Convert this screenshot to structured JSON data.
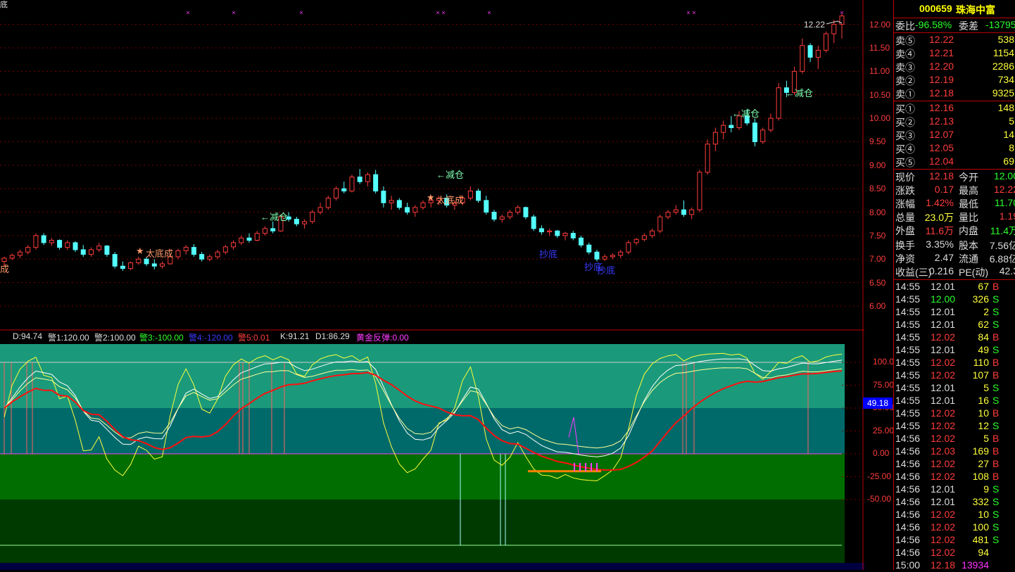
{
  "stock": {
    "code": "000659",
    "name": "珠海中富"
  },
  "order_book": {
    "wei_bi_label": "委比",
    "wei_bi": "-96.58%",
    "wei_cha_label": "委差",
    "wei_cha": "-13795",
    "sell": [
      {
        "label": "卖⑤",
        "price": "12.22",
        "vol": "538"
      },
      {
        "label": "卖④",
        "price": "12.21",
        "vol": "1154"
      },
      {
        "label": "卖③",
        "price": "12.20",
        "vol": "2286"
      },
      {
        "label": "卖②",
        "price": "12.19",
        "vol": "734"
      },
      {
        "label": "卖①",
        "price": "12.18",
        "vol": "9325"
      }
    ],
    "buy": [
      {
        "label": "买①",
        "price": "12.16",
        "vol": "148"
      },
      {
        "label": "买②",
        "price": "12.13",
        "vol": "5"
      },
      {
        "label": "买③",
        "price": "12.07",
        "vol": "14"
      },
      {
        "label": "买④",
        "price": "12.05",
        "vol": "8"
      },
      {
        "label": "买⑤",
        "price": "12.04",
        "vol": "69"
      }
    ]
  },
  "quote": [
    {
      "l1": "现价",
      "v1": "12.18",
      "c1": "r",
      "l2": "今开",
      "v2": "12.00",
      "c2": "g"
    },
    {
      "l1": "涨跌",
      "v1": "0.17",
      "c1": "r",
      "l2": "最高",
      "v2": "12.22",
      "c2": "r"
    },
    {
      "l1": "涨幅",
      "v1": "1.42%",
      "c1": "r",
      "l2": "最低",
      "v2": "11.70",
      "c2": "g"
    },
    {
      "l1": "总量",
      "v1": "23.0万",
      "c1": "y",
      "l2": "量比",
      "v2": "1.19",
      "c2": "r"
    },
    {
      "l1": "外盘",
      "v1": "11.6万",
      "c1": "r",
      "l2": "内盘",
      "v2": "11.4万",
      "c2": "g"
    },
    {
      "l1": "换手",
      "v1": "3.35%",
      "c1": "w",
      "l2": "股本",
      "v2": "7.56亿",
      "c2": "w"
    },
    {
      "l1": "净资",
      "v1": "2.47",
      "c1": "w",
      "l2": "流通",
      "v2": "6.88亿",
      "c2": "w"
    },
    {
      "l1": "收益(三)",
      "v1": "0.216",
      "c1": "w",
      "l2": "PE(动)",
      "v2": "42.3",
      "c2": "w"
    }
  ],
  "ticks": [
    {
      "t": "14:55",
      "p": "12.01",
      "pc": "w",
      "v": "67",
      "s": "B"
    },
    {
      "t": "14:55",
      "p": "12.00",
      "pc": "g",
      "v": "326",
      "s": "S"
    },
    {
      "t": "14:55",
      "p": "12.01",
      "pc": "w",
      "v": "2",
      "s": "S"
    },
    {
      "t": "14:55",
      "p": "12.01",
      "pc": "w",
      "v": "62",
      "s": "S"
    },
    {
      "t": "14:55",
      "p": "12.02",
      "pc": "r",
      "v": "84",
      "s": "B"
    },
    {
      "t": "14:55",
      "p": "12.01",
      "pc": "w",
      "v": "49",
      "s": "S"
    },
    {
      "t": "14:55",
      "p": "12.02",
      "pc": "r",
      "v": "110",
      "s": "B"
    },
    {
      "t": "14:55",
      "p": "12.02",
      "pc": "r",
      "v": "107",
      "s": "B"
    },
    {
      "t": "14:55",
      "p": "12.01",
      "pc": "w",
      "v": "5",
      "s": "S"
    },
    {
      "t": "14:55",
      "p": "12.01",
      "pc": "w",
      "v": "16",
      "s": "S"
    },
    {
      "t": "14:55",
      "p": "12.02",
      "pc": "r",
      "v": "10",
      "s": "B"
    },
    {
      "t": "14:55",
      "p": "12.02",
      "pc": "r",
      "v": "12",
      "s": "S"
    },
    {
      "t": "14:56",
      "p": "12.02",
      "pc": "r",
      "v": "5",
      "s": "B"
    },
    {
      "t": "14:56",
      "p": "12.03",
      "pc": "r",
      "v": "169",
      "s": "B"
    },
    {
      "t": "14:56",
      "p": "12.02",
      "pc": "r",
      "v": "27",
      "s": "B"
    },
    {
      "t": "14:56",
      "p": "12.02",
      "pc": "r",
      "v": "108",
      "s": "B"
    },
    {
      "t": "14:56",
      "p": "12.01",
      "pc": "w",
      "v": "9",
      "s": "S"
    },
    {
      "t": "14:56",
      "p": "12.01",
      "pc": "w",
      "v": "332",
      "s": "S"
    },
    {
      "t": "14:56",
      "p": "12.02",
      "pc": "r",
      "v": "10",
      "s": "S"
    },
    {
      "t": "14:56",
      "p": "12.02",
      "pc": "r",
      "v": "100",
      "s": "S"
    },
    {
      "t": "14:56",
      "p": "12.02",
      "pc": "r",
      "v": "481",
      "s": "S"
    },
    {
      "t": "14:56",
      "p": "12.02",
      "pc": "r",
      "v": "94",
      "s": ""
    },
    {
      "t": "15:00",
      "p": "12.18",
      "pc": "r",
      "v": "13934",
      "s": ""
    }
  ],
  "indicator_legend": [
    {
      "text": "D:94.74",
      "color": "#dddddd"
    },
    {
      "text": "警1:120.00",
      "color": "#dddddd"
    },
    {
      "text": "警2:100.00",
      "color": "#dddddd"
    },
    {
      "text": "警3:-100.00",
      "color": "#2cff2c"
    },
    {
      "text": "警4:-120.00",
      "color": "#3a3aff"
    },
    {
      "text": "警5:0.01",
      "color": "#ff3c3c"
    },
    {
      "text": "K:91.21",
      "color": "#dddddd"
    },
    {
      "text": "D1:86.29",
      "color": "#dddddd"
    },
    {
      "text": "黄金反弹:0.00",
      "color": "#ff3cff"
    }
  ],
  "main_axis": [
    "12.00",
    "11.50",
    "11.00",
    "10.50",
    "10.00",
    "9.50",
    "9.00",
    "8.50",
    "8.00",
    "7.50",
    "7.00",
    "6.50",
    "6.00"
  ],
  "ind_axis": [
    "100.0",
    "75.00",
    "50.00",
    "25.00",
    "0.00",
    "-25.00",
    "-50.00"
  ],
  "ind_current": "49.18",
  "annotations": {
    "high_label": "12.22",
    "jiancang": "←减仓",
    "taichengcheng": "太底成",
    "chaodi": "抄底",
    "left_edge": "成",
    "top_left": "底"
  },
  "chart_data": {
    "type": "candlestick",
    "ylim": [
      5.7,
      12.4
    ],
    "ohlc": [
      [
        6.95,
        7.05,
        6.85,
        7.02
      ],
      [
        7.02,
        7.12,
        6.98,
        7.08
      ],
      [
        7.08,
        7.2,
        7.02,
        7.15
      ],
      [
        7.15,
        7.3,
        7.1,
        7.25
      ],
      [
        7.25,
        7.55,
        7.2,
        7.5
      ],
      [
        7.5,
        7.55,
        7.3,
        7.35
      ],
      [
        7.35,
        7.45,
        7.28,
        7.4
      ],
      [
        7.4,
        7.42,
        7.2,
        7.25
      ],
      [
        7.25,
        7.4,
        7.2,
        7.35
      ],
      [
        7.35,
        7.38,
        7.15,
        7.2
      ],
      [
        7.2,
        7.3,
        7.05,
        7.1
      ],
      [
        7.1,
        7.25,
        7.05,
        7.2
      ],
      [
        7.2,
        7.35,
        7.15,
        7.28
      ],
      [
        7.28,
        7.3,
        7.05,
        7.1
      ],
      [
        7.1,
        7.15,
        6.8,
        6.85
      ],
      [
        6.85,
        6.95,
        6.75,
        6.8
      ],
      [
        6.8,
        6.95,
        6.76,
        6.92
      ],
      [
        6.92,
        7.05,
        6.88,
        7.0
      ],
      [
        7.0,
        7.05,
        6.85,
        6.9
      ],
      [
        6.9,
        7.0,
        6.78,
        6.85
      ],
      [
        6.85,
        6.95,
        6.8,
        6.9
      ],
      [
        6.9,
        7.1,
        6.88,
        7.05
      ],
      [
        7.05,
        7.22,
        7.0,
        7.18
      ],
      [
        7.18,
        7.3,
        7.1,
        7.25
      ],
      [
        7.25,
        7.32,
        7.05,
        7.1
      ],
      [
        7.1,
        7.15,
        6.95,
        7.0
      ],
      [
        7.0,
        7.1,
        6.95,
        7.05
      ],
      [
        7.05,
        7.2,
        7.0,
        7.15
      ],
      [
        7.15,
        7.3,
        7.1,
        7.26
      ],
      [
        7.26,
        7.4,
        7.2,
        7.35
      ],
      [
        7.35,
        7.5,
        7.3,
        7.45
      ],
      [
        7.45,
        7.55,
        7.35,
        7.4
      ],
      [
        7.4,
        7.6,
        7.38,
        7.55
      ],
      [
        7.55,
        7.7,
        7.5,
        7.65
      ],
      [
        7.65,
        7.8,
        7.55,
        7.6
      ],
      [
        7.6,
        7.95,
        7.58,
        7.9
      ],
      [
        7.9,
        8.0,
        7.8,
        7.85
      ],
      [
        7.85,
        7.9,
        7.7,
        7.75
      ],
      [
        7.75,
        7.85,
        7.65,
        7.8
      ],
      [
        7.8,
        8.05,
        7.75,
        8.0
      ],
      [
        8.0,
        8.2,
        7.95,
        8.1
      ],
      [
        8.1,
        8.35,
        8.05,
        8.3
      ],
      [
        8.3,
        8.55,
        8.25,
        8.5
      ],
      [
        8.5,
        8.65,
        8.4,
        8.45
      ],
      [
        8.45,
        8.8,
        8.42,
        8.75
      ],
      [
        8.75,
        8.92,
        8.6,
        8.65
      ],
      [
        8.65,
        8.85,
        8.55,
        8.8
      ],
      [
        8.8,
        8.9,
        8.4,
        8.45
      ],
      [
        8.45,
        8.55,
        8.1,
        8.2
      ],
      [
        8.2,
        8.35,
        8.05,
        8.25
      ],
      [
        8.25,
        8.3,
        8.05,
        8.1
      ],
      [
        8.1,
        8.2,
        7.95,
        8.0
      ],
      [
        8.0,
        8.15,
        7.9,
        8.1
      ],
      [
        8.1,
        8.25,
        8.05,
        8.2
      ],
      [
        8.2,
        8.3,
        8.1,
        8.25
      ],
      [
        8.25,
        8.35,
        8.15,
        8.3
      ],
      [
        8.3,
        8.38,
        8.1,
        8.15
      ],
      [
        8.15,
        8.25,
        8.05,
        8.2
      ],
      [
        8.2,
        8.35,
        8.15,
        8.3
      ],
      [
        8.3,
        8.55,
        8.25,
        8.45
      ],
      [
        8.45,
        8.5,
        8.2,
        8.25
      ],
      [
        8.25,
        8.35,
        7.95,
        8.0
      ],
      [
        8.0,
        8.05,
        7.8,
        7.85
      ],
      [
        7.85,
        7.95,
        7.78,
        7.9
      ],
      [
        7.9,
        8.05,
        7.85,
        8.0
      ],
      [
        8.0,
        8.15,
        7.95,
        8.1
      ],
      [
        8.1,
        8.12,
        7.85,
        7.9
      ],
      [
        7.9,
        7.95,
        7.6,
        7.65
      ],
      [
        7.65,
        7.72,
        7.52,
        7.58
      ],
      [
        7.58,
        7.65,
        7.5,
        7.6
      ],
      [
        7.6,
        7.62,
        7.45,
        7.5
      ],
      [
        7.5,
        7.58,
        7.4,
        7.55
      ],
      [
        7.55,
        7.6,
        7.4,
        7.45
      ],
      [
        7.45,
        7.5,
        7.25,
        7.3
      ],
      [
        7.3,
        7.35,
        7.1,
        7.15
      ],
      [
        7.15,
        7.2,
        6.95,
        7.0
      ],
      [
        7.0,
        7.1,
        6.96,
        7.05
      ],
      [
        7.05,
        7.12,
        7.0,
        7.08
      ],
      [
        7.08,
        7.2,
        7.02,
        7.15
      ],
      [
        7.15,
        7.4,
        7.1,
        7.35
      ],
      [
        7.35,
        7.45,
        7.3,
        7.42
      ],
      [
        7.42,
        7.55,
        7.38,
        7.5
      ],
      [
        7.5,
        7.65,
        7.45,
        7.6
      ],
      [
        7.6,
        7.95,
        7.55,
        7.9
      ],
      [
        7.9,
        8.05,
        7.85,
        8.0
      ],
      [
        8.0,
        8.15,
        7.95,
        8.05
      ],
      [
        8.05,
        8.25,
        7.9,
        7.95
      ],
      [
        7.95,
        8.1,
        7.85,
        8.05
      ],
      [
        8.05,
        8.9,
        8.0,
        8.85
      ],
      [
        8.85,
        9.55,
        8.8,
        9.45
      ],
      [
        9.45,
        9.8,
        9.3,
        9.7
      ],
      [
        9.7,
        9.95,
        9.55,
        9.85
      ],
      [
        9.85,
        10.05,
        9.7,
        9.8
      ],
      [
        9.8,
        10.15,
        9.75,
        10.05
      ],
      [
        10.05,
        10.2,
        9.85,
        9.9
      ],
      [
        9.9,
        10.0,
        9.4,
        9.5
      ],
      [
        9.5,
        9.8,
        9.45,
        9.75
      ],
      [
        9.75,
        10.1,
        9.7,
        10.0
      ],
      [
        10.0,
        10.75,
        9.95,
        10.65
      ],
      [
        10.65,
        10.8,
        10.45,
        10.55
      ],
      [
        10.55,
        11.1,
        10.5,
        11.0
      ],
      [
        11.0,
        11.7,
        10.95,
        11.55
      ],
      [
        11.55,
        11.6,
        11.2,
        11.3
      ],
      [
        11.3,
        11.55,
        11.05,
        11.45
      ],
      [
        11.45,
        11.85,
        11.4,
        11.8
      ],
      [
        11.8,
        12.1,
        11.6,
        12.0
      ],
      [
        12.0,
        12.22,
        11.7,
        12.18
      ]
    ]
  }
}
